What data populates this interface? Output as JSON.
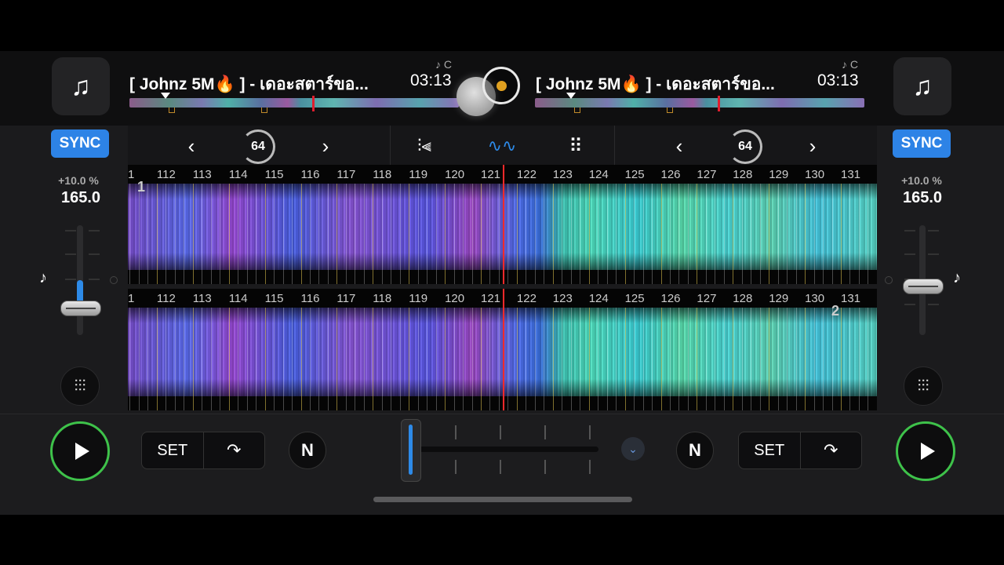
{
  "deckA": {
    "title": "[ Johnz 5M🔥 ] - เดอะสตาร์ขอ...",
    "time": "03:13",
    "key": "♪ C",
    "sync_label": "SYNC",
    "pitch_percent": "+10.0 %",
    "bpm": "165.0",
    "pitch_level_percent": 75,
    "loop_size": "64",
    "cue_set_label": "SET",
    "deck_number": "1"
  },
  "deckB": {
    "title": "[ Johnz 5M🔥 ] - เดอะสตาร์ขอ...",
    "time": "03:13",
    "key": "♪ C",
    "sync_label": "SYNC",
    "pitch_percent": "+10.0 %",
    "bpm": "165.0",
    "pitch_level_percent": 55,
    "loop_size": "64",
    "cue_set_label": "SET",
    "deck_number": "2"
  },
  "beats": [
    "1",
    "112",
    "113",
    "114",
    "115",
    "116",
    "117",
    "118",
    "119",
    "120",
    "121",
    "122",
    "123",
    "124",
    "125",
    "126",
    "127",
    "128",
    "129",
    "130",
    "131"
  ],
  "icons": {
    "library": "music-note-icon",
    "prev": "chevron-left-icon",
    "next": "chevron-right-icon",
    "fx": "equalizer-icon",
    "waveform": "waveform-icon",
    "pads": "grid-icon",
    "play": "play-icon",
    "mixer": "mixer-icon",
    "n_button": "n-logo-icon"
  },
  "colors": {
    "sync": "#2d83e6",
    "play_ring": "#3ec24a",
    "playhead": "#ff2a2a",
    "record": "#e0a020"
  }
}
